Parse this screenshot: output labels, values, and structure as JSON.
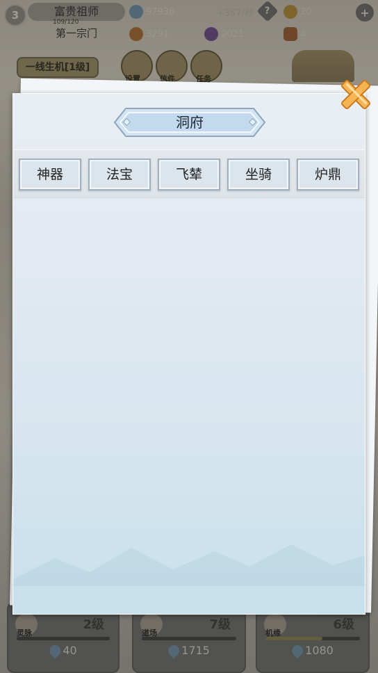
{
  "hud": {
    "level": "3",
    "player_name": "富贵祖师",
    "hp_text": "109/120",
    "sect_name": "第一宗门",
    "spirit_stones": "97938",
    "spirit_rate": "+357/秒",
    "gold_ingots": "20",
    "fire_res": "3291",
    "purple_res": "2021",
    "treasure_chests": "4",
    "help_icon": "question-icon",
    "add_icon": "plus-icon"
  },
  "scene": {
    "banner": "一线生机[1级]",
    "settings_label": "设置",
    "mail_label": "信件",
    "task_label": "任务"
  },
  "bottom_cards": [
    {
      "name": "灵脉",
      "level": "2级",
      "cost": "40",
      "progress": 0.0
    },
    {
      "name": "道场",
      "level": "7级",
      "cost": "1715",
      "progress": 0.0
    },
    {
      "name": "机缘",
      "level": "6级",
      "cost": "1080",
      "progress": 0.6
    }
  ],
  "dialog": {
    "title": "洞府",
    "tabs": [
      "神器",
      "法宝",
      "飞辇",
      "坐骑",
      "炉鼎"
    ],
    "close_icon": "close-x-icon"
  },
  "colors": {
    "panel_bg": "#e2e9f1",
    "tab_border": "#9fb0c0",
    "close_orange": "#f3a640",
    "title_plaque": "#cfe2f3"
  }
}
